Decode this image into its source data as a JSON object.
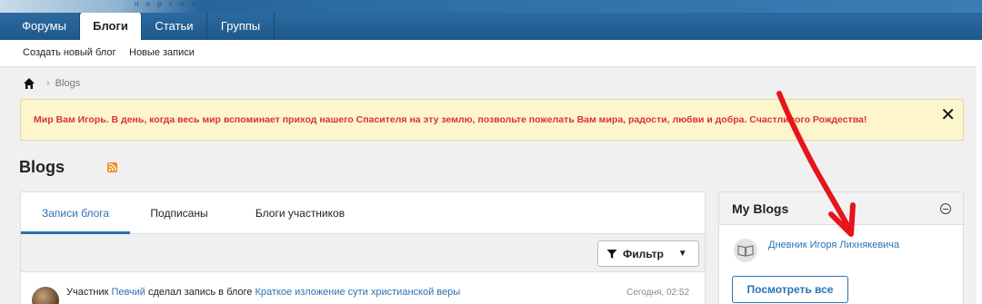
{
  "banner": {
    "logo_text": "п о р т а л"
  },
  "nav": {
    "tabs": [
      {
        "label": "Форумы"
      },
      {
        "label": "Блоги"
      },
      {
        "label": "Статьи"
      },
      {
        "label": "Группы"
      }
    ]
  },
  "subnav": {
    "create_blog": "Создать новый блог",
    "new_posts": "Новые записи"
  },
  "breadcrumb": {
    "current": "Blogs"
  },
  "notice": {
    "text": "Мир Вам Игорь. В день, когда весь мир вспоминает приход нашего Спасителя на эту землю, позвольте пожелать Вам мира, радости, любви и добра. Счастливого Рождества!",
    "close": "✕"
  },
  "page": {
    "title": "Blogs"
  },
  "main": {
    "tabs": [
      {
        "label": "Записи блога"
      },
      {
        "label": "Подписаны"
      },
      {
        "label": "Блоги участников"
      }
    ],
    "filter_label": "Фильтр",
    "post": {
      "prefix": "Участник",
      "author": "Певчий",
      "middle": "сделал запись в блоге",
      "blog_title": "Краткое изложение сути христианской веры",
      "time": "Сегодня, 02:52"
    }
  },
  "sidebar": {
    "title": "My Blogs",
    "blog_link": "Дневник Игоря Лихнякевича",
    "view_all": "Посмотреть все"
  },
  "colors": {
    "accent": "#2a72b5",
    "nav": "#20588a",
    "notice_bg": "#fdf6cc",
    "notice_text": "#e03030",
    "annotation_arrow": "#e8141c"
  }
}
